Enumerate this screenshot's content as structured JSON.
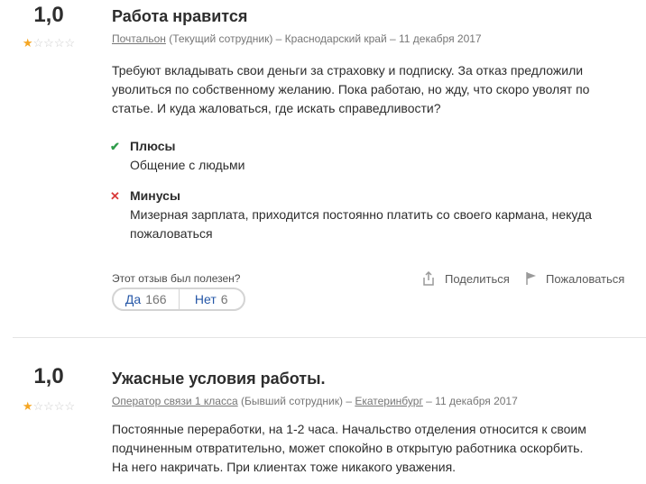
{
  "reviews": [
    {
      "rating": "1,0",
      "stars_filled": 1,
      "stars_total": 5,
      "title": "Работа нравится",
      "job_title": "Почтальон",
      "employment": " (Текущий сотрудник) –  ",
      "location": "Краснодарский край",
      "date": " – 11 декабря 2017",
      "text": "Требуют вкладывать свои деньги за страховку и подписку. За отказ предложили уволиться по собственному желанию. Пока работаю, но жду, что скоро уволят по статье. И куда жаловаться, где искать справедливости?",
      "pros_label": "Плюсы",
      "pros": "Общение с людьми",
      "cons_label": "Минусы",
      "cons": "Мизерная зарплата, приходится постоянно платить со своего кармана, некуда пожаловаться",
      "helpful_question": "Этот отзыв был полезен?",
      "yes_label": "Да",
      "yes_count": "166",
      "no_label": "Нет",
      "no_count": "6",
      "share_label": "Поделиться",
      "report_label": "Пожаловаться"
    },
    {
      "rating": "1,0",
      "stars_filled": 1,
      "stars_total": 5,
      "title": "Ужасные условия работы.",
      "job_title": "Оператор связи 1 класса",
      "employment": " (Бывший сотрудник) –  ",
      "location": "Екатеринбург",
      "date": " – 11 декабря 2017",
      "text": "Постоянные переработки, на 1-2 часа. Начальство отделения относится к своим подчиненным отвратительно, может спокойно в открытую работника оскорбить. На него накричать. При клиентах тоже никакого уважения."
    }
  ],
  "icons": {
    "check": "check-icon",
    "cross": "cross-icon",
    "star": "star-icon",
    "share": "share-icon",
    "flag": "flag-icon"
  },
  "colors": {
    "star": "#f5a623",
    "check": "#2e9c4a",
    "cross": "#d93a3a",
    "link": "#2557a7"
  }
}
